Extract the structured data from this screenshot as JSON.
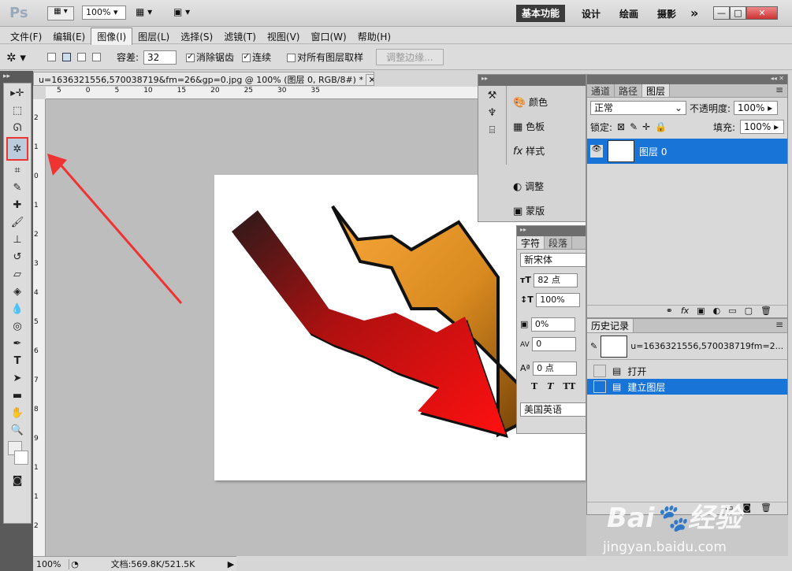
{
  "app": {
    "logo": "Ps",
    "zoom": "100%"
  },
  "workspaces": {
    "active": "基本功能",
    "items": [
      "设计",
      "绘画",
      "摄影"
    ],
    "more": "»"
  },
  "menu": [
    "文件(F)",
    "编辑(E)",
    "图像(I)",
    "图层(L)",
    "选择(S)",
    "滤镜(T)",
    "视图(V)",
    "窗口(W)",
    "帮助(H)"
  ],
  "options": {
    "tolerance_label": "容差:",
    "tolerance": "32",
    "antialias": "消除锯齿",
    "contiguous": "连续",
    "sample_all": "对所有图层取样",
    "refine": "调整边缘..."
  },
  "document": {
    "tab": "u=1636321556,570038719&fm=26&gp=0.jpg @ 100% (图层 0, RGB/8#) *",
    "close": "✕"
  },
  "ruler_h": [
    "5",
    "0",
    "5",
    "10",
    "15",
    "20",
    "25",
    "30",
    "35"
  ],
  "ruler_v": [
    "2",
    "1",
    "0",
    "1",
    "2",
    "3",
    "4",
    "5",
    "6",
    "7",
    "8",
    "9",
    "1",
    "1",
    "2"
  ],
  "status": {
    "zoom": "100%",
    "doc": "文档:569.8K/521.5K"
  },
  "mini_panel": {
    "items": [
      "颜色",
      "色板",
      "样式",
      "调整",
      "蒙版"
    ]
  },
  "char_panel": {
    "tabs": [
      "字符",
      "段落"
    ],
    "font": "新宋体",
    "size": "82 点",
    "leading": "100%",
    "scale": "0%",
    "tracking": "0",
    "baseline": "0 点",
    "styles": [
      "T",
      "T",
      "TT"
    ],
    "lang": "美国英语"
  },
  "layers_panel": {
    "tabs": [
      "通道",
      "路径",
      "图层"
    ],
    "blend": "正常",
    "opacity_label": "不透明度:",
    "opacity": "100%",
    "lock_label": "锁定:",
    "fill_label": "填充:",
    "fill": "100%",
    "layer": "图层 0"
  },
  "history_panel": {
    "title": "历史记录",
    "snapshot": "u=1636321556,570038719fm=2...",
    "items": [
      "打开",
      "建立图层"
    ]
  },
  "watermark": {
    "brand": "Bai",
    "brand2": "经验",
    "url": "jingyan.baidu.com"
  }
}
